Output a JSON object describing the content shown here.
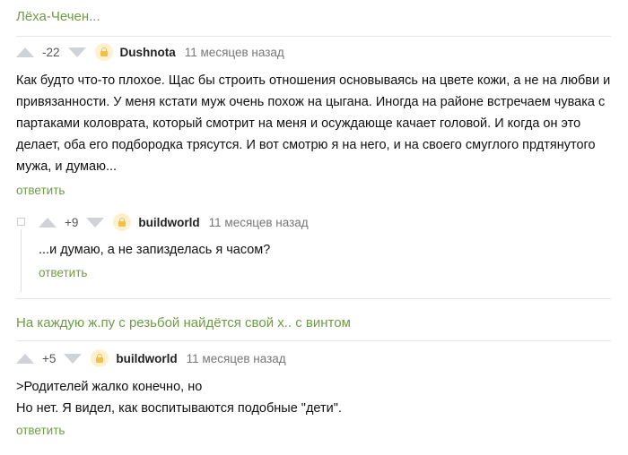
{
  "thread1": {
    "parent_link": "Лёха-Чечен...",
    "comment": {
      "score": "-22",
      "user": "Dushnota",
      "time": "11 месяцев назад",
      "lines": [
        "Как будто что-то плохое. Щас бы строить отношения основываясь на цвете кожи, а не на любви и",
        "привязанности. У меня кстати муж очень похож на цыгана. Иногда на районе встречаем чувака с",
        "партаками коловрата, который смотрит на меня и осуждающе качает головой. И когда он это",
        "делает, оба его подбородка трясутся. И вот смотрю я на него, и на своего смуглого прдтянутого",
        "мужа, и думаю..."
      ],
      "reply_label": "ответить"
    },
    "reply": {
      "score": "+9",
      "user": "buildworld",
      "time": "11 месяцев назад",
      "text": "...и думаю, а не запизделась я часом?",
      "reply_label": "ответить"
    }
  },
  "thread2": {
    "parent_link": "На каждую ж.пу с резьбой найдётся свой х.. с винтом",
    "comment": {
      "score": "+5",
      "user": "buildworld",
      "time": "11 месяцев назад",
      "lines": [
        ">Родителей жалко конечно, но",
        "Но нет. Я видел, как воспитываются подобные \"дети\"."
      ],
      "reply_label": "ответить"
    }
  }
}
